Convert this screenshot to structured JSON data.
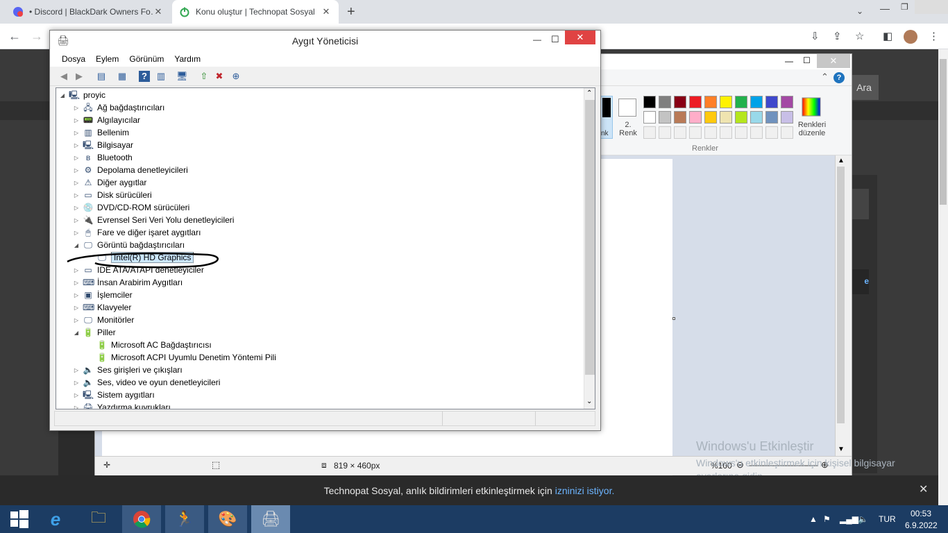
{
  "browser": {
    "tabs": [
      {
        "label": "• Discord | BlackDark Owners Fo…",
        "close": "✕"
      },
      {
        "label": "Konu oluştur | Technopat Sosyal",
        "close": "✕"
      }
    ],
    "new_tab": "+"
  },
  "page": {
    "ara_button": "Ara",
    "notification": {
      "text": "Technopat Sosyal, anlık bildirimleri etkinleştirmek için",
      "link": "izninizi istiyor.",
      "close": "✕"
    },
    "watermark": {
      "title": "Windows'u Etkinleştir",
      "subtitle": "Windows'u etkinleştirmek için kişisel bilgisayar ayarlarına gidin."
    }
  },
  "paint": {
    "color2_label": "2. Renk",
    "color1_label": "nk",
    "edit_colors_label": "Renkleri düzenle",
    "colors_group_label": "Renkler",
    "status_size": "819 × 460px",
    "zoom": "%100",
    "palette_row1": [
      "#000000",
      "#7f7f7f",
      "#880015",
      "#ed1c24",
      "#ff7f27",
      "#fff200",
      "#22b14c",
      "#00a2e8",
      "#3f48cc",
      "#a349a4"
    ],
    "palette_row2": [
      "#ffffff",
      "#c3c3c3",
      "#b97a57",
      "#ffaec9",
      "#ffc90e",
      "#efe4b0",
      "#b5e61d",
      "#99d9ea",
      "#7092be",
      "#c8bfe7"
    ]
  },
  "device_manager": {
    "title": "Aygıt Yöneticisi",
    "menu": [
      "Dosya",
      "Eylem",
      "Görünüm",
      "Yardım"
    ],
    "tree": {
      "root": "proyic",
      "items": [
        {
          "label": "Ağ bağdaştırıcıları",
          "state": "collapsed"
        },
        {
          "label": "Algılayıcılar",
          "state": "collapsed"
        },
        {
          "label": "Bellenim",
          "state": "collapsed"
        },
        {
          "label": "Bilgisayar",
          "state": "collapsed"
        },
        {
          "label": "Bluetooth",
          "state": "collapsed"
        },
        {
          "label": "Depolama denetleyicileri",
          "state": "collapsed"
        },
        {
          "label": "Diğer aygıtlar",
          "state": "collapsed"
        },
        {
          "label": "Disk sürücüleri",
          "state": "collapsed"
        },
        {
          "label": "DVD/CD-ROM sürücüleri",
          "state": "collapsed"
        },
        {
          "label": "Evrensel Seri Veri Yolu denetleyicileri",
          "state": "collapsed"
        },
        {
          "label": "Fare ve diğer işaret aygıtları",
          "state": "collapsed"
        },
        {
          "label": "Görüntü bağdaştırıcıları",
          "state": "expanded"
        },
        {
          "label": "Intel(R) HD Graphics",
          "state": "child-selected"
        },
        {
          "label": "IDE ATA/ATAPI denetleyiciler",
          "state": "collapsed"
        },
        {
          "label": "İnsan Arabirim Aygıtları",
          "state": "collapsed"
        },
        {
          "label": "İşlemciler",
          "state": "collapsed"
        },
        {
          "label": "Klavyeler",
          "state": "collapsed"
        },
        {
          "label": "Monitörler",
          "state": "collapsed"
        },
        {
          "label": "Piller",
          "state": "expanded"
        },
        {
          "label": "Microsoft AC Bağdaştırıcısı",
          "state": "child"
        },
        {
          "label": "Microsoft ACPI Uyumlu Denetim Yöntemi Pili",
          "state": "child"
        },
        {
          "label": "Ses girişleri ve çıkışları",
          "state": "collapsed"
        },
        {
          "label": "Ses, video ve oyun denetleyicileri",
          "state": "collapsed"
        },
        {
          "label": "Sistem aygıtları",
          "state": "collapsed"
        },
        {
          "label": "Yazdırma kuyrukları",
          "state": "collapsed"
        }
      ]
    }
  },
  "taskbar": {
    "language": "TUR",
    "time": "00:53",
    "date": "6.9.2022"
  }
}
